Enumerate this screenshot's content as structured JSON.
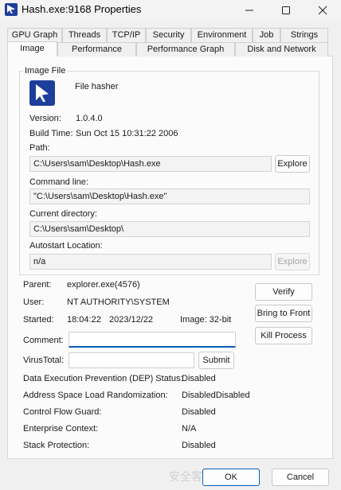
{
  "window": {
    "title": "Hash.exe:9168 Properties"
  },
  "tabs_row1": [
    "GPU Graph",
    "Threads",
    "TCP/IP",
    "Security",
    "Environment",
    "Job",
    "Strings"
  ],
  "tabs_row2": [
    "Image",
    "Performance",
    "Performance Graph",
    "Disk and Network"
  ],
  "active_tab": "Image",
  "image_file": {
    "legend": "Image File",
    "description": "File hasher",
    "version_label": "Version:",
    "version": "1.0.4.0",
    "build_time_label": "Build Time:",
    "build_time": "Sun Oct 15 10:31:22 2006",
    "path_label": "Path:",
    "path": "C:\\Users\\sam\\Desktop\\Hash.exe",
    "explore_label": "Explore",
    "command_line_label": "Command line:",
    "command_line": "\"C:\\Users\\sam\\Desktop\\Hash.exe\"",
    "current_dir_label": "Current directory:",
    "current_dir": "C:\\Users\\sam\\Desktop\\",
    "autostart_label": "Autostart Location:",
    "autostart": "n/a",
    "explore2_label": "Explore"
  },
  "process": {
    "parent_label": "Parent:",
    "parent": "explorer.exe(4576)",
    "user_label": "User:",
    "user": "NT AUTHORITY\\SYSTEM",
    "started_label": "Started:",
    "started_time": "18:04:22",
    "started_date": "2023/12/22",
    "image_label": "Image: 32-bit",
    "comment_label": "Comment:",
    "comment": "",
    "virustotal_label": "VirusTotal:",
    "submit_label": "Submit",
    "verify_label": "Verify",
    "bring_to_front_label": "Bring to Front",
    "kill_process_label": "Kill Process"
  },
  "security": [
    {
      "label": "Data Execution Prevention (DEP) Status:",
      "value": "Disabled"
    },
    {
      "label": "Address Space Load Randomization:",
      "value": "DisabledDisabled"
    },
    {
      "label": "Control Flow Guard:",
      "value": "Disabled"
    },
    {
      "label": "Enterprise Context:",
      "value": "N/A"
    },
    {
      "label": "Stack Protection:",
      "value": "Disabled"
    }
  ],
  "footer": {
    "watermark": "安全客",
    "ok_label": "OK",
    "cancel_label": "Cancel"
  }
}
